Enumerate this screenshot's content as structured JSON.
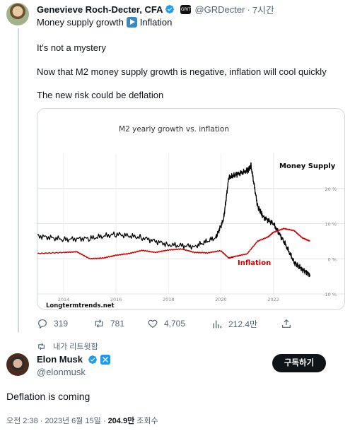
{
  "retweeted_tweet": {
    "author_name": "Genevieve Roch-Decter, CFA",
    "author_handle": "@GRDecter",
    "time_ago": "7시간",
    "profile_badge_text": "GRIT",
    "text_lines": [
      "Money supply growth",
      "Inflation",
      "It's not a mystery",
      "Now that M2 money supply growth is negative, inflation will cool quickly",
      "The new risk could be deflation"
    ],
    "counts": {
      "replies": "319",
      "retweets": "781",
      "likes": "4,705",
      "views": "212.4만"
    }
  },
  "chart_data": {
    "type": "line",
    "title": "M2 yearly growth vs. inflation",
    "x_ticks": [
      "2014",
      "2016",
      "2018",
      "2020",
      "2022"
    ],
    "y_ticks": [
      "20 %",
      "10 %",
      "0 %",
      "-10 %"
    ],
    "ylim": [
      -10,
      30
    ],
    "xlim": [
      2013,
      2024.2
    ],
    "grid": true,
    "series": [
      {
        "name": "Money Supply",
        "color": "#000000",
        "x": [
          2013.0,
          2014.0,
          2015.0,
          2016.0,
          2017.0,
          2018.0,
          2019.0,
          2019.8,
          2020.1,
          2020.3,
          2020.6,
          2021.0,
          2021.15,
          2021.4,
          2021.6,
          2022.0,
          2022.4,
          2022.8,
          2023.1,
          2023.4
        ],
        "y": [
          6.5,
          5.5,
          5.8,
          7.0,
          6.0,
          4.0,
          3.5,
          6.0,
          11,
          23,
          24,
          25,
          26.5,
          15,
          12,
          10,
          5,
          -1,
          -3,
          -4.5
        ]
      },
      {
        "name": "Inflation",
        "color": "#cc0000",
        "x": [
          2013.0,
          2014.0,
          2014.5,
          2015.0,
          2015.5,
          2016.0,
          2016.5,
          2017.0,
          2017.5,
          2018.0,
          2018.5,
          2019.0,
          2019.5,
          2020.0,
          2020.3,
          2020.5,
          2021.0,
          2021.4,
          2021.8,
          2022.0,
          2022.4,
          2022.8,
          2023.1,
          2023.4
        ],
        "y": [
          1.5,
          1.8,
          2.0,
          0.0,
          0.2,
          1.0,
          1.5,
          2.4,
          1.8,
          2.5,
          2.8,
          1.8,
          1.7,
          2.3,
          0.2,
          0.6,
          1.4,
          5.0,
          6.2,
          7.5,
          8.6,
          8.0,
          6.0,
          5.0
        ]
      }
    ],
    "annotations": [
      "Money Supply",
      "Inflation"
    ],
    "source_label": "Longtermtrends.net"
  },
  "retweet_note": "내가 리트윗함",
  "main_tweet": {
    "author_name": "Elon Musk",
    "author_handle": "@elonmusk",
    "subscribe_label": "구독하기",
    "text": "Deflation is coming",
    "timestamp": "오전 2:38 · 2023년 6월 15일 · ",
    "views_count": "204.9만",
    "views_label": " 조회수"
  },
  "colors": {
    "accent": "#1d9bf0",
    "text": "#0f1419",
    "muted": "#536471",
    "border": "#cfd9de"
  }
}
